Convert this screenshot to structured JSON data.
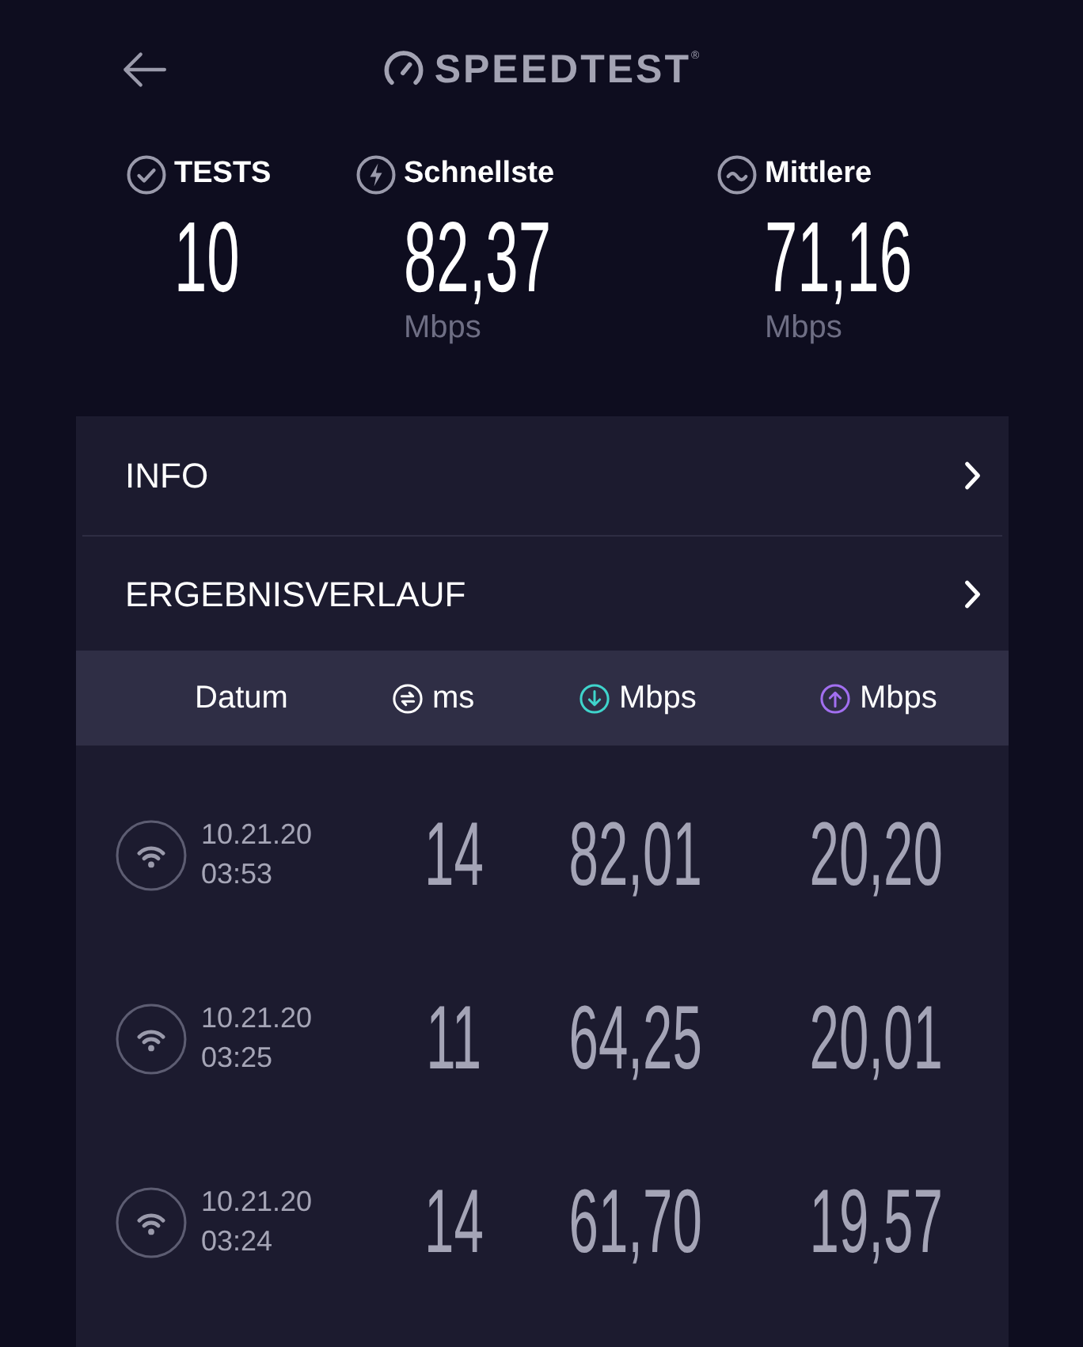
{
  "header": {
    "logo": {
      "text": "SPEEDTEST",
      "mark": "®"
    }
  },
  "stats": [
    {
      "kind": "tests",
      "label": "TESTS",
      "value": "10"
    },
    {
      "kind": "fastest",
      "label": "Schnellste",
      "value": "82,37",
      "unit": "Mbps"
    },
    {
      "kind": "average",
      "label": "Mittlere",
      "value": "71,16",
      "unit": "Mbps"
    }
  ],
  "menu": [
    {
      "label": "INFO"
    },
    {
      "label": "ERGEBNISVERLAUF"
    }
  ],
  "table": {
    "columns": [
      {
        "kind": "date",
        "label": "Datum"
      },
      {
        "kind": "ping",
        "label": "ms"
      },
      {
        "kind": "download",
        "label": "Mbps"
      },
      {
        "kind": "upload",
        "label": "Mbps"
      }
    ],
    "rows": [
      {
        "date": "10.21.20",
        "time": "03:53",
        "ping": "14",
        "download": "82,01",
        "upload": "20,20"
      },
      {
        "date": "10.21.20",
        "time": "03:25",
        "ping": "11",
        "download": "64,25",
        "upload": "20,01"
      },
      {
        "date": "10.21.20",
        "time": "03:24",
        "ping": "14",
        "download": "61,70",
        "upload": "19,57"
      }
    ]
  }
}
